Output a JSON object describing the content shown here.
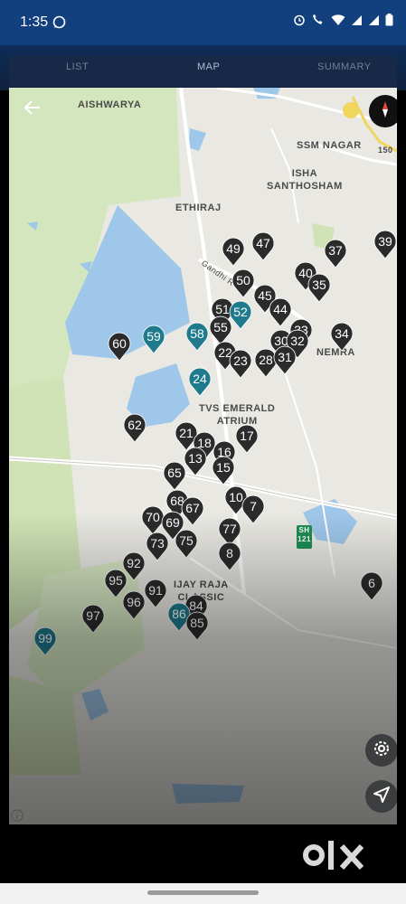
{
  "status_bar": {
    "time": "1:35"
  },
  "tabs": [
    {
      "label": "LIST"
    },
    {
      "label": "MAP",
      "active": true
    },
    {
      "label": "SUMMARY"
    }
  ],
  "map_labels": {
    "aishwarya": "AISHWARYA",
    "ssm_nagar": "SSM NAGAR",
    "isha_santhosham": "ISHA\nSANTHOSHAM",
    "ethiraj": "ETHIRAJ",
    "gandhi_road": "Gandhi R",
    "nemra": "NEMRA",
    "tvs_emerald_atrium": "TVS EMERALD\nATRIUM",
    "vijay_raja_classic": "IJAY RAJA\nCLASSIC",
    "road_150": "150",
    "sh_121": "SH\n121"
  },
  "pins": [
    {
      "n": "49",
      "c": "dark"
    },
    {
      "n": "47",
      "c": "dark"
    },
    {
      "n": "39",
      "c": "dark"
    },
    {
      "n": "37",
      "c": "dark"
    },
    {
      "n": "50",
      "c": "dark"
    },
    {
      "n": "45",
      "c": "dark"
    },
    {
      "n": "40",
      "c": "dark"
    },
    {
      "n": "35",
      "c": "dark"
    },
    {
      "n": "51",
      "c": "dark"
    },
    {
      "n": "52",
      "c": "teal"
    },
    {
      "n": "44",
      "c": "dark"
    },
    {
      "n": "34",
      "c": "dark"
    },
    {
      "n": "60",
      "c": "dark"
    },
    {
      "n": "59",
      "c": "teal"
    },
    {
      "n": "58",
      "c": "teal"
    },
    {
      "n": "55",
      "c": "dark"
    },
    {
      "n": "30",
      "c": "dark"
    },
    {
      "n": "22",
      "c": "dark"
    },
    {
      "n": "28",
      "c": "dark"
    },
    {
      "n": "24",
      "c": "teal"
    },
    {
      "n": "62",
      "c": "dark"
    },
    {
      "n": "21",
      "c": "dark"
    },
    {
      "n": "17",
      "c": "dark"
    },
    {
      "n": "18",
      "c": "dark"
    },
    {
      "n": "16",
      "c": "dark"
    },
    {
      "n": "65",
      "c": "dark"
    },
    {
      "n": "15",
      "c": "dark"
    },
    {
      "n": "10",
      "c": "dark"
    },
    {
      "n": "68",
      "c": "dark"
    },
    {
      "n": "67",
      "c": "dark"
    },
    {
      "n": "7",
      "c": "dark"
    },
    {
      "n": "70",
      "c": "dark"
    },
    {
      "n": "69",
      "c": "dark"
    },
    {
      "n": "77",
      "c": "dark"
    },
    {
      "n": "73",
      "c": "dark"
    },
    {
      "n": "75",
      "c": "dark"
    },
    {
      "n": "92",
      "c": "dark"
    },
    {
      "n": "95",
      "c": "dark"
    },
    {
      "n": "91",
      "c": "dark"
    },
    {
      "n": "6",
      "c": "dark"
    },
    {
      "n": "96",
      "c": "dark"
    },
    {
      "n": "84",
      "c": "dark"
    },
    {
      "n": "86",
      "c": "teal"
    },
    {
      "n": "85",
      "c": "dark"
    },
    {
      "n": "97",
      "c": "dark"
    },
    {
      "n": "99",
      "c": "teal"
    },
    {
      "n": "33",
      "c": "dark"
    },
    {
      "n": "32",
      "c": "dark"
    },
    {
      "n": "31",
      "c": "dark"
    },
    {
      "n": "23",
      "c": "dark"
    },
    {
      "n": "13",
      "c": "dark"
    },
    {
      "n": "8",
      "c": "dark"
    }
  ],
  "icons": {
    "back": "arrow-left-icon",
    "compass": "compass-icon",
    "settings": "gear-icon",
    "locate": "navigation-arrow-icon",
    "info": "info-icon"
  },
  "colors": {
    "pin_dark": "#2b2b2b",
    "pin_teal": "#1e7a8c",
    "water": "#9fc7ea",
    "park": "#cfe3b6"
  },
  "watermark": "OLX"
}
